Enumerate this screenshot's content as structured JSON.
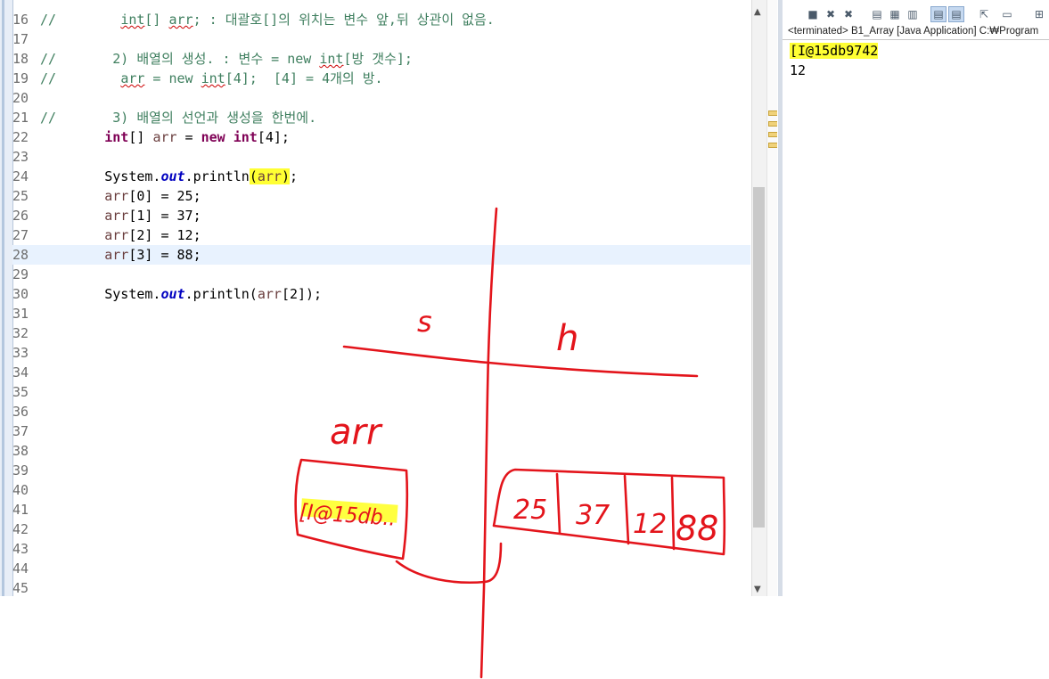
{
  "editor": {
    "lines": [
      {
        "n": "16",
        "parts": [
          {
            "t": "//        ",
            "c": "cm"
          },
          {
            "t": "int",
            "c": "cm squig"
          },
          {
            "t": "[] ",
            "c": "cm"
          },
          {
            "t": "arr",
            "c": "cm squig"
          },
          {
            "t": "; : 대괄호[]의 위치는 변수 앞,뒤 상관이 없음.",
            "c": "cm"
          }
        ]
      },
      {
        "n": "17",
        "parts": []
      },
      {
        "n": "18",
        "parts": [
          {
            "t": "//       2) 배열의 생성. : 변수 = new ",
            "c": "cm"
          },
          {
            "t": "int",
            "c": "cm squig"
          },
          {
            "t": "[방 갯수];",
            "c": "cm"
          }
        ]
      },
      {
        "n": "19",
        "parts": [
          {
            "t": "//        ",
            "c": "cm"
          },
          {
            "t": "arr",
            "c": "cm squig"
          },
          {
            "t": " = new ",
            "c": "cm"
          },
          {
            "t": "int",
            "c": "cm squig"
          },
          {
            "t": "[4];  [4] = 4개의 방.",
            "c": "cm"
          }
        ]
      },
      {
        "n": "20",
        "parts": []
      },
      {
        "n": "21",
        "parts": [
          {
            "t": "//       3) 배열의 선언과 생성을 한번에.",
            "c": "cm"
          }
        ]
      },
      {
        "n": "22",
        "parts": [
          {
            "t": "        "
          },
          {
            "t": "int",
            "c": "kw"
          },
          {
            "t": "[] "
          },
          {
            "t": "arr",
            "c": "var"
          },
          {
            "t": " = "
          },
          {
            "t": "new",
            "c": "kw"
          },
          {
            "t": " "
          },
          {
            "t": "int",
            "c": "kw"
          },
          {
            "t": "[4];"
          }
        ]
      },
      {
        "n": "23",
        "parts": []
      },
      {
        "n": "24",
        "parts": [
          {
            "t": "        System."
          },
          {
            "t": "out",
            "c": "fld"
          },
          {
            "t": ".println"
          },
          {
            "t": "(",
            "c": "mark"
          },
          {
            "t": "arr",
            "c": "var mark"
          },
          {
            "t": ")",
            "c": "mark"
          },
          {
            "t": ";"
          }
        ]
      },
      {
        "n": "25",
        "parts": [
          {
            "t": "        "
          },
          {
            "t": "arr",
            "c": "var"
          },
          {
            "t": "[0] = 25;"
          }
        ]
      },
      {
        "n": "26",
        "parts": [
          {
            "t": "        "
          },
          {
            "t": "arr",
            "c": "var"
          },
          {
            "t": "[1] = 37;"
          }
        ]
      },
      {
        "n": "27",
        "parts": [
          {
            "t": "        "
          },
          {
            "t": "arr",
            "c": "var"
          },
          {
            "t": "[2] = 12;"
          }
        ]
      },
      {
        "n": "28",
        "parts": [
          {
            "t": "        "
          },
          {
            "t": "arr",
            "c": "var"
          },
          {
            "t": "[3] = 88;"
          }
        ],
        "current": true
      },
      {
        "n": "29",
        "parts": []
      },
      {
        "n": "30",
        "parts": [
          {
            "t": "        System."
          },
          {
            "t": "out",
            "c": "fld"
          },
          {
            "t": ".println("
          },
          {
            "t": "arr",
            "c": "var"
          },
          {
            "t": "[2]);"
          }
        ]
      },
      {
        "n": "31",
        "parts": []
      },
      {
        "n": "32",
        "parts": []
      },
      {
        "n": "33",
        "parts": []
      },
      {
        "n": "34",
        "parts": []
      },
      {
        "n": "35",
        "parts": []
      },
      {
        "n": "36",
        "parts": []
      },
      {
        "n": "37",
        "parts": []
      },
      {
        "n": "38",
        "parts": []
      },
      {
        "n": "39",
        "parts": []
      },
      {
        "n": "40",
        "parts": []
      },
      {
        "n": "41",
        "parts": []
      },
      {
        "n": "42",
        "parts": []
      },
      {
        "n": "43",
        "parts": []
      },
      {
        "n": "44",
        "parts": []
      },
      {
        "n": "45",
        "parts": []
      }
    ]
  },
  "console": {
    "status": "<terminated> B1_Array [Java Application] C:₩Program",
    "output": [
      "[I@15db9742",
      "12"
    ],
    "toolbar_icons": [
      "terminate-icon",
      "remove-launch-icon",
      "remove-all-icon",
      "clear-console-icon",
      "scroll-lock-icon",
      "word-wrap-icon",
      "show-stdout-icon",
      "show-stderr-icon",
      "pin-console-icon",
      "display-console-icon",
      "open-console-icon"
    ]
  },
  "annotation": {
    "stack_label": "s",
    "heap_label": "h",
    "variable_label": "arr",
    "reference_value": "[I@15db..",
    "array_cells": [
      "25",
      "37",
      "12",
      "88"
    ],
    "ink_color": "#e3141b",
    "highlight_color": "#ffff00"
  }
}
